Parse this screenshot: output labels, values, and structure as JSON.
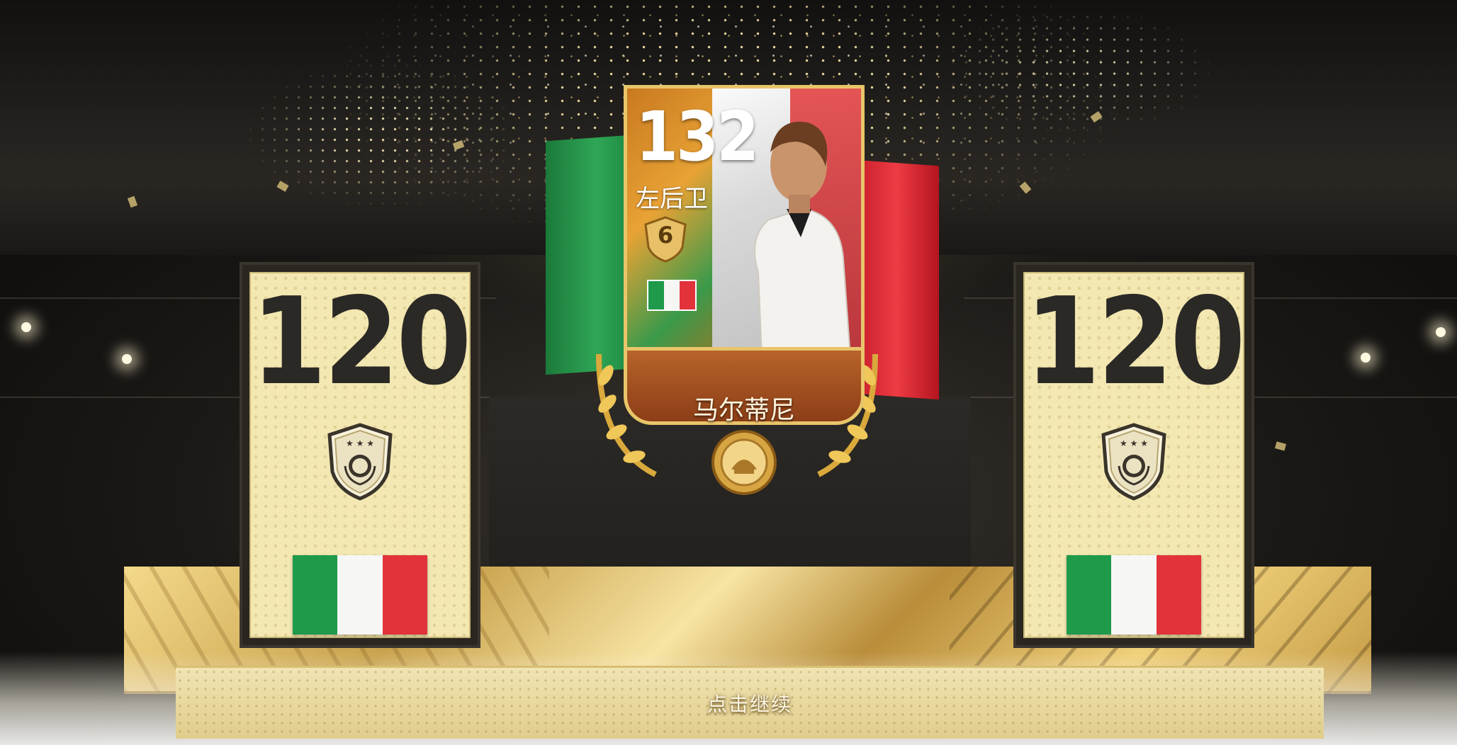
{
  "featured_card": {
    "rating": "132",
    "position": "左后卫",
    "rank_level": "6",
    "player_name": "马尔蒂尼",
    "nationality_flag": [
      "#1f9a4a",
      "#f6f6f4",
      "#e2333b"
    ]
  },
  "side_cards": [
    {
      "rating": "120",
      "badge_icon": "icon-shield-badge",
      "flag_colors": [
        "#1f9a4a",
        "#f6f6f4",
        "#e2333b"
      ]
    },
    {
      "rating": "120",
      "badge_icon": "icon-shield-badge",
      "flag_colors": [
        "#1f9a4a",
        "#f6f6f4",
        "#e2333b"
      ]
    }
  ],
  "continue_prompt": "点击继续",
  "colors": {
    "gold": "#e9c56a",
    "card_cream": "#f3e7b2",
    "italy_green": "#1f9a4a",
    "italy_red": "#e2333b"
  }
}
